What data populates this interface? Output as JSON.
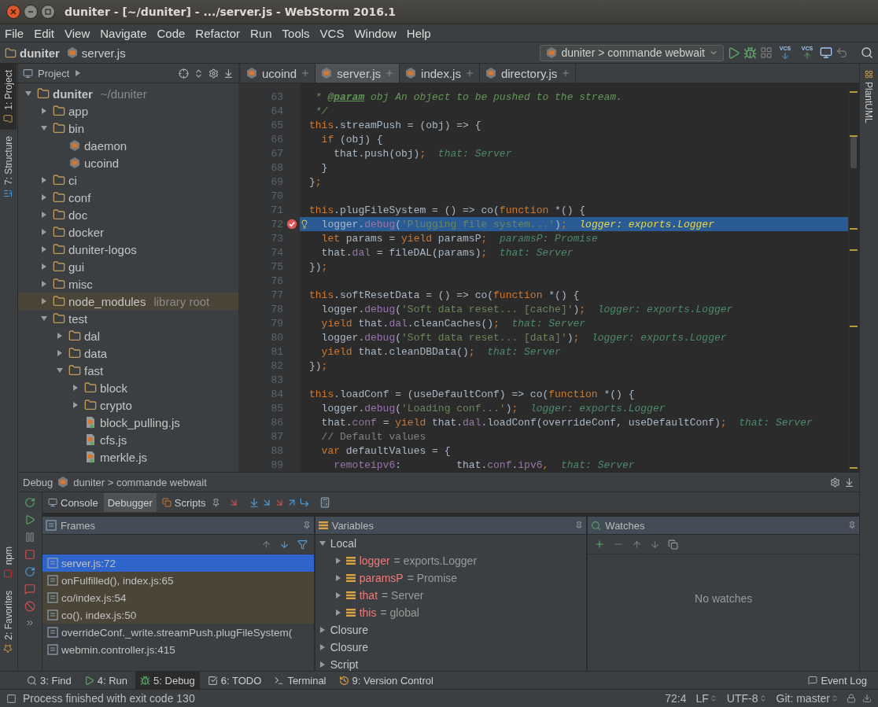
{
  "window": {
    "title": "duniter - [~/duniter] - .../server.js - WebStorm 2016.1"
  },
  "menu": [
    "File",
    "Edit",
    "View",
    "Navigate",
    "Code",
    "Refactor",
    "Run",
    "Tools",
    "VCS",
    "Window",
    "Help"
  ],
  "breadcrumbs": [
    "duniter",
    "server.js"
  ],
  "run_config": "duniter > commande webwait",
  "vcs_buttons": [
    {
      "label": "VCS",
      "kind": "update"
    },
    {
      "label": "VCS",
      "kind": "commit"
    }
  ],
  "left_strip": {
    "top": [
      {
        "label": "1: Project",
        "selected": true
      },
      {
        "label": "7: Structure",
        "selected": false
      }
    ],
    "bottom": [
      {
        "label": "npm",
        "selected": false
      },
      {
        "label": "2: Favorites",
        "selected": false
      }
    ]
  },
  "right_strip": [
    {
      "label": "PlantUML"
    }
  ],
  "project": {
    "title": "Project",
    "tree": [
      {
        "label": "duniter",
        "note": "~/duniter",
        "kind": "folder",
        "expanded": true,
        "library": false,
        "children": [
          {
            "label": "app",
            "kind": "folder",
            "expanded": false,
            "library": false
          },
          {
            "label": "bin",
            "kind": "folder",
            "expanded": true,
            "library": false,
            "children": [
              {
                "label": "daemon",
                "kind": "script",
                "library": false
              },
              {
                "label": "ucoind",
                "kind": "script",
                "library": false
              }
            ]
          },
          {
            "label": "ci",
            "kind": "folder",
            "expanded": false,
            "library": false
          },
          {
            "label": "conf",
            "kind": "folder",
            "expanded": false,
            "library": false
          },
          {
            "label": "doc",
            "kind": "folder",
            "expanded": false,
            "library": false
          },
          {
            "label": "docker",
            "kind": "folder",
            "expanded": false,
            "library": false
          },
          {
            "label": "duniter-logos",
            "kind": "folder",
            "expanded": false,
            "library": false
          },
          {
            "label": "gui",
            "kind": "folder",
            "expanded": false,
            "library": false
          },
          {
            "label": "misc",
            "kind": "folder",
            "expanded": false,
            "library": false
          },
          {
            "label": "node_modules",
            "note": "library root",
            "kind": "folder",
            "expanded": false,
            "library": true
          },
          {
            "label": "test",
            "kind": "folder",
            "expanded": true,
            "library": false,
            "children": [
              {
                "label": "dal",
                "kind": "folder",
                "expanded": false,
                "library": false
              },
              {
                "label": "data",
                "kind": "folder",
                "expanded": false,
                "library": false
              },
              {
                "label": "fast",
                "kind": "folder",
                "expanded": true,
                "library": false,
                "children": [
                  {
                    "label": "block",
                    "kind": "folder",
                    "expanded": false,
                    "library": false
                  },
                  {
                    "label": "crypto",
                    "kind": "folder",
                    "expanded": false,
                    "library": false
                  },
                  {
                    "label": "block_pulling.js",
                    "kind": "test",
                    "library": false
                  },
                  {
                    "label": "cfs.js",
                    "kind": "test",
                    "library": false
                  },
                  {
                    "label": "merkle.js",
                    "kind": "test",
                    "library": false
                  }
                ]
              }
            ]
          }
        ]
      }
    ]
  },
  "editor": {
    "tabs": [
      {
        "label": "ucoind",
        "selected": false
      },
      {
        "label": "server.js",
        "selected": true
      },
      {
        "label": "index.js",
        "selected": false
      },
      {
        "label": "directory.js",
        "selected": false
      }
    ],
    "lines": [
      {
        "number": "63",
        "breakpoint": false,
        "current": false,
        "tokens": [
          {
            "text": " * ",
            "kind": "doc"
          },
          {
            "text": "@param",
            "kind": "doctag"
          },
          {
            "text": " obj An object to be pushed to the stream.",
            "kind": "doc"
          }
        ]
      },
      {
        "number": "64",
        "breakpoint": false,
        "current": false,
        "tokens": [
          {
            "text": " */",
            "kind": "doc"
          }
        ]
      },
      {
        "number": "65",
        "breakpoint": false,
        "current": false,
        "tokens": [
          {
            "text": "this",
            "kind": "kw"
          },
          {
            "text": ".streamPush = (obj) => {",
            "kind": "plain"
          }
        ]
      },
      {
        "number": "66",
        "breakpoint": false,
        "current": false,
        "tokens": [
          {
            "text": "  if",
            "kind": "kw"
          },
          {
            "text": " (obj) {",
            "kind": "plain"
          }
        ]
      },
      {
        "number": "67",
        "breakpoint": false,
        "current": false,
        "tokens": [
          {
            "text": "    that.push(obj)",
            "kind": "plain"
          },
          {
            "text": ";",
            "kind": "kw"
          },
          {
            "text": "  that: Server",
            "kind": "hint"
          }
        ]
      },
      {
        "number": "68",
        "breakpoint": false,
        "current": false,
        "tokens": [
          {
            "text": "  }",
            "kind": "plain"
          }
        ]
      },
      {
        "number": "69",
        "breakpoint": false,
        "current": false,
        "tokens": [
          {
            "text": "}",
            "kind": "plain"
          },
          {
            "text": ";",
            "kind": "kw"
          }
        ]
      },
      {
        "number": "70",
        "breakpoint": false,
        "current": false
      },
      {
        "number": "71",
        "breakpoint": false,
        "current": false,
        "tokens": [
          {
            "text": "this",
            "kind": "kw"
          },
          {
            "text": ".plugFileSystem = () => co(",
            "kind": "plain"
          },
          {
            "text": "function",
            "kind": "kw"
          },
          {
            "text": " *() {",
            "kind": "plain"
          }
        ]
      },
      {
        "number": "72",
        "breakpoint": true,
        "current": true,
        "tokens": [
          {
            "text": "  logger.",
            "kind": "plain"
          },
          {
            "text": "debug",
            "kind": "method"
          },
          {
            "text": "(",
            "kind": "plain"
          },
          {
            "text": "'Plugging file system...'",
            "kind": "str"
          },
          {
            "text": ")",
            "kind": "plain"
          },
          {
            "text": ";",
            "kind": "kw"
          },
          {
            "text": "  logger: exports.Logger",
            "kind": "hint"
          }
        ]
      },
      {
        "number": "73",
        "breakpoint": false,
        "current": false,
        "tokens": [
          {
            "text": "  let",
            "kind": "kw"
          },
          {
            "text": " params = ",
            "kind": "plain"
          },
          {
            "text": "yield",
            "kind": "kw"
          },
          {
            "text": " paramsP",
            "kind": "plain"
          },
          {
            "text": ";",
            "kind": "kw"
          },
          {
            "text": "  paramsP: Promise",
            "kind": "hint"
          }
        ]
      },
      {
        "number": "74",
        "breakpoint": false,
        "current": false,
        "tokens": [
          {
            "text": "  that.",
            "kind": "plain"
          },
          {
            "text": "dal",
            "kind": "method"
          },
          {
            "text": " = fileDAL(params)",
            "kind": "plain"
          },
          {
            "text": ";",
            "kind": "kw"
          },
          {
            "text": "  that: Server",
            "kind": "hint"
          }
        ]
      },
      {
        "number": "75",
        "breakpoint": false,
        "current": false,
        "tokens": [
          {
            "text": "})",
            "kind": "plain"
          },
          {
            "text": ";",
            "kind": "kw"
          }
        ]
      },
      {
        "number": "76",
        "breakpoint": false,
        "current": false
      },
      {
        "number": "77",
        "breakpoint": false,
        "current": false,
        "tokens": [
          {
            "text": "this",
            "kind": "kw"
          },
          {
            "text": ".softResetData = () => co(",
            "kind": "plain"
          },
          {
            "text": "function",
            "kind": "kw"
          },
          {
            "text": " *() {",
            "kind": "plain"
          }
        ]
      },
      {
        "number": "78",
        "breakpoint": false,
        "current": false,
        "tokens": [
          {
            "text": "  logger.",
            "kind": "plain"
          },
          {
            "text": "debug",
            "kind": "method"
          },
          {
            "text": "(",
            "kind": "plain"
          },
          {
            "text": "'Soft data reset... [cache]'",
            "kind": "str"
          },
          {
            "text": ")",
            "kind": "plain"
          },
          {
            "text": ";",
            "kind": "kw"
          },
          {
            "text": "  logger: exports.Logger",
            "kind": "hint"
          }
        ]
      },
      {
        "number": "79",
        "breakpoint": false,
        "current": false,
        "tokens": [
          {
            "text": "  yield",
            "kind": "kw"
          },
          {
            "text": " that.",
            "kind": "plain"
          },
          {
            "text": "dal",
            "kind": "method"
          },
          {
            "text": ".cleanCaches()",
            "kind": "plain"
          },
          {
            "text": ";",
            "kind": "kw"
          },
          {
            "text": "  that: Server",
            "kind": "hint"
          }
        ]
      },
      {
        "number": "80",
        "breakpoint": false,
        "current": false,
        "tokens": [
          {
            "text": "  logger.",
            "kind": "plain"
          },
          {
            "text": "debug",
            "kind": "method"
          },
          {
            "text": "(",
            "kind": "plain"
          },
          {
            "text": "'Soft data reset... [data]'",
            "kind": "str"
          },
          {
            "text": ")",
            "kind": "plain"
          },
          {
            "text": ";",
            "kind": "kw"
          },
          {
            "text": "  logger: exports.Logger",
            "kind": "hint"
          }
        ]
      },
      {
        "number": "81",
        "breakpoint": false,
        "current": false,
        "tokens": [
          {
            "text": "  yield",
            "kind": "kw"
          },
          {
            "text": " that.cleanDBData()",
            "kind": "plain"
          },
          {
            "text": ";",
            "kind": "kw"
          },
          {
            "text": "  that: Server",
            "kind": "hint"
          }
        ]
      },
      {
        "number": "82",
        "breakpoint": false,
        "current": false,
        "tokens": [
          {
            "text": "})",
            "kind": "plain"
          },
          {
            "text": ";",
            "kind": "kw"
          }
        ]
      },
      {
        "number": "83",
        "breakpoint": false,
        "current": false
      },
      {
        "number": "84",
        "breakpoint": false,
        "current": false,
        "tokens": [
          {
            "text": "this",
            "kind": "kw"
          },
          {
            "text": ".loadConf = (useDefaultConf) => co(",
            "kind": "plain"
          },
          {
            "text": "function",
            "kind": "kw"
          },
          {
            "text": " *() {",
            "kind": "plain"
          }
        ]
      },
      {
        "number": "85",
        "breakpoint": false,
        "current": false,
        "tokens": [
          {
            "text": "  logger.",
            "kind": "plain"
          },
          {
            "text": "debug",
            "kind": "method"
          },
          {
            "text": "(",
            "kind": "plain"
          },
          {
            "text": "'Loading conf...'",
            "kind": "str"
          },
          {
            "text": ")",
            "kind": "plain"
          },
          {
            "text": ";",
            "kind": "kw"
          },
          {
            "text": "  logger: exports.Logger",
            "kind": "hint"
          }
        ]
      },
      {
        "number": "86",
        "breakpoint": false,
        "current": false,
        "tokens": [
          {
            "text": "  that.",
            "kind": "plain"
          },
          {
            "text": "conf",
            "kind": "method"
          },
          {
            "text": " = ",
            "kind": "plain"
          },
          {
            "text": "yield",
            "kind": "kw"
          },
          {
            "text": " that.",
            "kind": "plain"
          },
          {
            "text": "dal",
            "kind": "method"
          },
          {
            "text": ".loadConf(overrideConf, useDefaultConf)",
            "kind": "plain"
          },
          {
            "text": ";",
            "kind": "kw"
          },
          {
            "text": "  that: Server",
            "kind": "hint"
          }
        ]
      },
      {
        "number": "87",
        "breakpoint": false,
        "current": false,
        "tokens": [
          {
            "text": "  // Default values",
            "kind": "comment"
          }
        ]
      },
      {
        "number": "88",
        "breakpoint": false,
        "current": false,
        "tokens": [
          {
            "text": "  var",
            "kind": "kw"
          },
          {
            "text": " defaultValues = {",
            "kind": "plain"
          }
        ]
      },
      {
        "number": "89",
        "breakpoint": false,
        "current": false,
        "tokens": [
          {
            "text": "    remoteipv6",
            "kind": "method"
          },
          {
            "text": ":         that.",
            "kind": "plain"
          },
          {
            "text": "conf",
            "kind": "method"
          },
          {
            "text": ".",
            "kind": "plain"
          },
          {
            "text": "ipv6",
            "kind": "method"
          },
          {
            "text": ",",
            "kind": "kw"
          },
          {
            "text": "  that: Server",
            "kind": "hint"
          }
        ]
      }
    ]
  },
  "debug": {
    "title": "Debug",
    "config": "duniter > commande webwait",
    "tabs": [
      {
        "label": "Console",
        "selected": false
      },
      {
        "label": "Debugger",
        "selected": true
      },
      {
        "label": "Scripts",
        "selected": false
      }
    ],
    "frames": {
      "title": "Frames",
      "items": [
        {
          "label": "server.js:72",
          "selected": true,
          "library": false
        },
        {
          "label": "onFulfilled(), index.js:65",
          "selected": false,
          "library": true
        },
        {
          "label": "co/index.js:54",
          "selected": false,
          "library": true
        },
        {
          "label": "co(), index.js:50",
          "selected": false,
          "library": true
        },
        {
          "label": "overrideConf._write.streamPush.plugFileSystem(",
          "selected": false,
          "library": false
        },
        {
          "label": "webmin.controller.js:415",
          "selected": false,
          "library": false
        }
      ]
    },
    "variables": {
      "title": "Variables",
      "items": [
        {
          "label": "Local",
          "expanded": true,
          "children": [
            {
              "name": "logger",
              "value": "= exports.Logger",
              "expanded": false
            },
            {
              "name": "paramsP",
              "value": "= Promise",
              "expanded": false
            },
            {
              "name": "that",
              "value": "= Server",
              "expanded": false
            },
            {
              "name": "this",
              "value": "= global",
              "expanded": false
            }
          ]
        },
        {
          "label": "Closure",
          "expanded": false
        },
        {
          "label": "Closure",
          "expanded": false
        },
        {
          "label": "Script",
          "expanded": false
        }
      ]
    },
    "watches": {
      "title": "Watches",
      "empty": "No watches"
    }
  },
  "tool_windows": [
    {
      "label": "3: Find",
      "kind": "find",
      "selected": false
    },
    {
      "label": "4: Run",
      "kind": "run",
      "selected": false
    },
    {
      "label": "5: Debug",
      "kind": "debug",
      "selected": true
    },
    {
      "label": "6: TODO",
      "kind": "todo",
      "selected": false
    },
    {
      "label": "Terminal",
      "kind": "terminal",
      "selected": false
    },
    {
      "label": "9: Version Control",
      "kind": "vcs",
      "selected": false
    }
  ],
  "event_log": "Event Log",
  "status": {
    "message": "Process finished with exit code 130",
    "position": "72:4",
    "line_separator": "LF",
    "encoding": "UTF-8",
    "branch": "Git: master"
  }
}
